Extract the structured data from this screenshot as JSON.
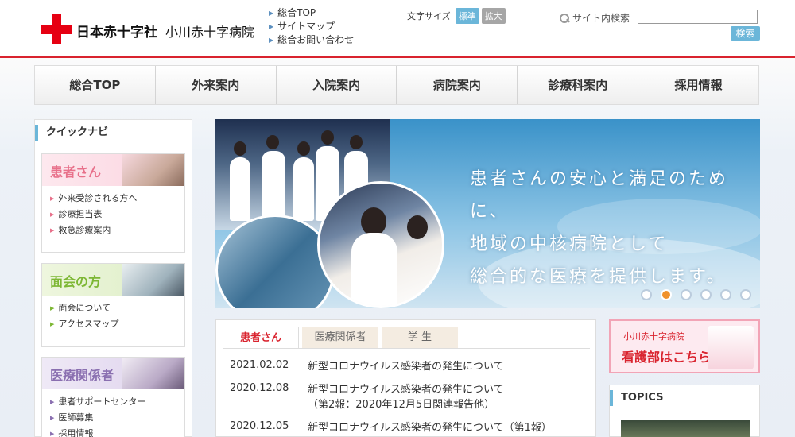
{
  "header": {
    "org_name": "日本赤十字社",
    "hospital_name": "小川赤十字病院",
    "links": [
      "総合TOP",
      "サイトマップ",
      "総合お問い合わせ"
    ],
    "font_size_label": "文字サイズ",
    "font_size_standard": "標準",
    "font_size_large": "拡大",
    "search_label": "サイト内検索",
    "search_value": "",
    "search_button": "検索"
  },
  "gnav": [
    "総合TOP",
    "外来案内",
    "入院案内",
    "病院案内",
    "診療科案内",
    "採用情報"
  ],
  "sidebar": {
    "title": "クイックナビ",
    "sections": [
      {
        "heading": "患者さん",
        "color": "#e8708a",
        "items": [
          "外来受診される方へ",
          "診療担当表",
          "救急診療案内"
        ]
      },
      {
        "heading": "面会の方",
        "color": "#7db734",
        "items": [
          "面会について",
          "アクセスマップ"
        ]
      },
      {
        "heading": "医療関係者",
        "color": "#8a6fb0",
        "items": [
          "患者サポートセンター",
          "医師募集",
          "採用情報"
        ]
      }
    ]
  },
  "hero": {
    "lines": [
      "患者さんの安心と満足のために、",
      "地域の中核病院として",
      "総合的な医療を提供します。"
    ],
    "slides": 6,
    "active_slide": 2
  },
  "news": {
    "tabs": [
      "患者さん",
      "医療関係者",
      "学 生"
    ],
    "active_tab": 0,
    "items": [
      {
        "date": "2021.02.02",
        "title": "新型コロナウイルス感染者の発生について",
        "sub": ""
      },
      {
        "date": "2020.12.08",
        "title": "新型コロナウイルス感染者の発生について",
        "sub": "（第2報：2020年12月5日関連報告他）"
      },
      {
        "date": "2020.12.05",
        "title": "新型コロナウイルス感染者の発生について（第1報）",
        "sub": ""
      }
    ]
  },
  "banner": {
    "small": "小川赤十字病院",
    "big": "看護部はこちら"
  },
  "topics": {
    "title": "TOPICS"
  },
  "colors": {
    "accent": "#6bb6d9",
    "brand_red": "#e60012"
  }
}
